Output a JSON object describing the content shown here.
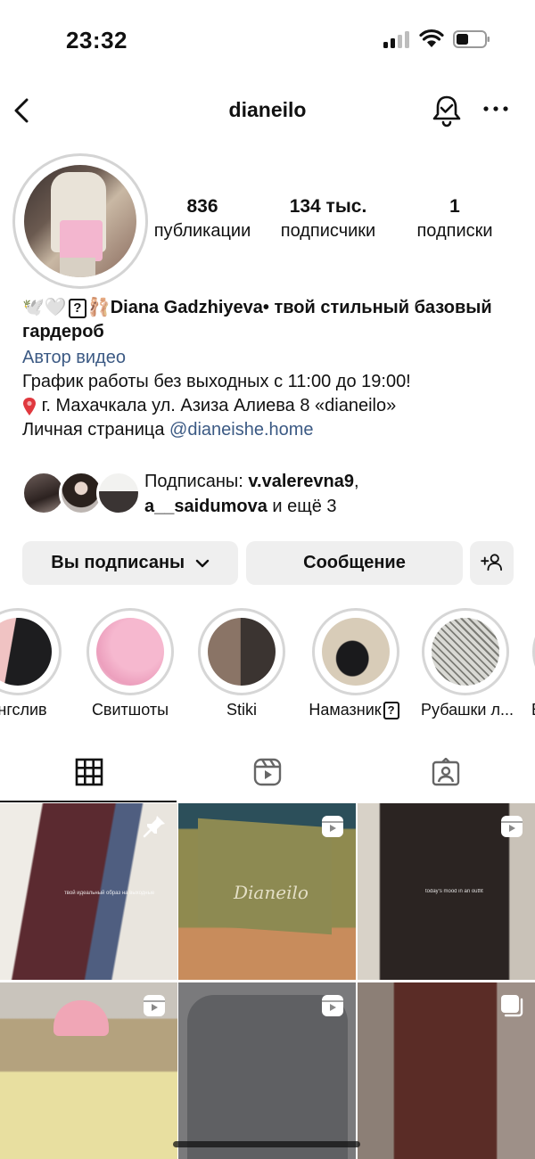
{
  "status_bar": {
    "time": "23:32"
  },
  "nav": {
    "title": "dianeilo"
  },
  "profile": {
    "stats": [
      {
        "value": "836",
        "label": "публикации"
      },
      {
        "value": "134 тыс.",
        "label": "подписчики"
      },
      {
        "value": "1",
        "label": "подписки"
      }
    ],
    "bio": {
      "emoji_prefix": "🕊️🤍",
      "emoji_after_box": "🩰",
      "name_line": "Diana Gadzhiyeva• твой стильный базовый гардероб",
      "category": "Автор видео",
      "line1": "График работы без выходных с 11:00 до 19:00!",
      "line2": "г. Махачкала ул. Азиза Алиева 8 «dianeilo»",
      "line3_prefix": "Личная страница ",
      "line3_link": "@dianeishe.home"
    },
    "followed_by": {
      "prefix": "Подписаны: ",
      "user1": "v.valerevna9",
      "sep": ",",
      "user2": "a__saidumova",
      "suffix": " и ещё 3"
    }
  },
  "buttons": {
    "following": "Вы подписаны",
    "message": "Сообщение"
  },
  "highlights": [
    {
      "label": "онгслив"
    },
    {
      "label": "Свитшоты"
    },
    {
      "label": "Stiki"
    },
    {
      "label": "Намазник"
    },
    {
      "label": "Рубашки л..."
    },
    {
      "label": "Б"
    }
  ],
  "tabs": [
    "grid",
    "reels",
    "tagged"
  ],
  "icons": {
    "back": "chevron-left-icon",
    "bell": "bell-icon",
    "more": "more-icon",
    "add_person": "add-person-icon",
    "grid_tab": "grid-icon",
    "reels_tab": "reels-icon",
    "tagged_tab": "tagged-icon",
    "pin": "pushpin-icon",
    "reel_badge": "reels-badge-icon",
    "carousel_badge": "carousel-icon"
  },
  "colors": {
    "link": "#3c5a84",
    "button_bg": "#efefef",
    "ring": "#d6d6d6"
  },
  "grid_posts": [
    {
      "caption": "твой идеальный образ на выходные",
      "badge": "pin"
    },
    {
      "caption": "Dianeilo",
      "badge": "reel"
    },
    {
      "caption": "today's mood in an outfit",
      "badge": "reel"
    },
    {
      "caption": "",
      "badge": "reel"
    },
    {
      "caption": "",
      "badge": "reel"
    },
    {
      "caption": "",
      "badge": "carousel"
    }
  ]
}
